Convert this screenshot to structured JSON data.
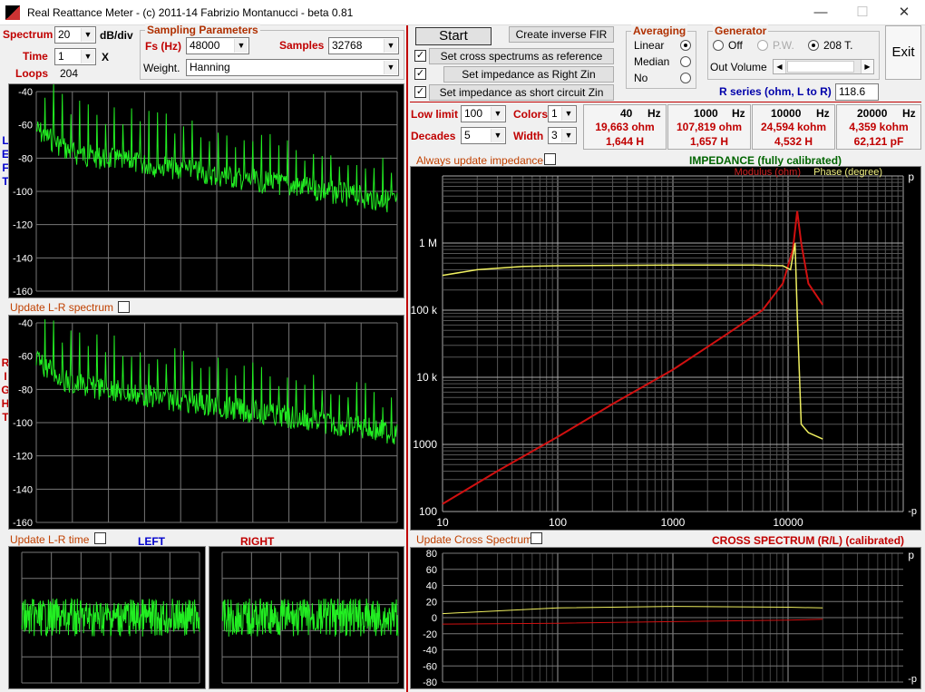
{
  "window": {
    "title": "Real Reattance Meter - (c) 2011-14 Fabrizio Montanucci - beta 0.81"
  },
  "left": {
    "spectrum_label": "Spectrum",
    "spectrum_value": "20",
    "spectrum_unit": "dB/div",
    "time_label": "Time",
    "time_value": "1",
    "time_unit": "X",
    "loops_label": "Loops",
    "loops_value": "204",
    "sampling_title": "Sampling Parameters",
    "fs_label": "Fs (Hz)",
    "fs_value": "48000",
    "samples_label": "Samples",
    "samples_value": "32768",
    "weight_label": "Weight.",
    "weight_value": "Hanning",
    "left_side_letters": [
      "L",
      "E",
      "F",
      "T"
    ],
    "right_side_letters": [
      "R",
      "I",
      "G",
      "H",
      "T"
    ],
    "spectrum_ticks": [
      "-40",
      "-60",
      "-80",
      "-100",
      "-120",
      "-140",
      "-160"
    ],
    "update_lr_spectrum": "Update L-R spectrum",
    "update_lr_time": "Update L-R time",
    "time_left_title": "LEFT",
    "time_right_title": "RIGHT"
  },
  "controls": {
    "start": "Start",
    "create_fir": "Create inverse FIR",
    "cross_ref": "Set cross spectrums as reference",
    "imp_right": "Set impedance as Right Zin",
    "imp_short": "Set impedance as short circuit Zin",
    "avg_title": "Averaging",
    "avg_linear": "Linear",
    "avg_median": "Median",
    "avg_no": "No",
    "gen_title": "Generator",
    "gen_off": "Off",
    "gen_pw": "P.W.",
    "gen_208": "208 T.",
    "out_volume": "Out Volume",
    "exit": "Exit",
    "rseries_label": "R series (ohm, L to R)",
    "rseries_value": "118.6",
    "low_limit_label": "Low limit",
    "low_limit_value": "100",
    "decades_label": "Decades",
    "decades_value": "5",
    "colors_label": "Colors",
    "colors_value": "1",
    "width_label": "Width",
    "width_value": "3",
    "always_update": "Always update impedance"
  },
  "readouts": [
    {
      "freq": "40",
      "unit": "Hz",
      "r": "19,663 ohm",
      "x": "1,644 H"
    },
    {
      "freq": "1000",
      "unit": "Hz",
      "r": "107,819 ohm",
      "x": "1,657 H"
    },
    {
      "freq": "10000",
      "unit": "Hz",
      "r": "24,594 kohm",
      "x": "4,532 H"
    },
    {
      "freq": "20000",
      "unit": "Hz",
      "r": "4,359 kohm",
      "x": "62,121 pF"
    }
  ],
  "impedance": {
    "title": "IMPEDANCE (fully calibrated)",
    "legend_mod": "Modulus (ohm)",
    "legend_phase": "Phase (degree)",
    "y_ticks": [
      "1 M",
      "100 k",
      "10 k",
      "1000",
      "100"
    ],
    "x_ticks": [
      "10",
      "100",
      "1000",
      "10000"
    ],
    "right_top": "p",
    "right_bottom": "-p",
    "colors": {
      "modulus": "#d01010",
      "phase": "#f0f060",
      "grid": "#888888"
    }
  },
  "cross": {
    "update_label": "Update Cross Spectrum",
    "title": "CROSS SPECTRUM (R/L) (calibrated)",
    "y_ticks": [
      "80",
      "60",
      "40",
      "20",
      "0",
      "-20",
      "-40",
      "-60",
      "-80"
    ],
    "right_top": "p",
    "right_bottom": "-p"
  },
  "chart_data": [
    {
      "type": "line",
      "title": "IMPEDANCE (fully calibrated)",
      "xscale": "log",
      "yscale": "log",
      "xlim": [
        10,
        100000
      ],
      "ylim": [
        100,
        10000000
      ],
      "series": [
        {
          "name": "Modulus (ohm)",
          "x": [
            10,
            30,
            100,
            300,
            1000,
            3000,
            6000,
            9000,
            11000,
            12000,
            13000,
            15000,
            20000
          ],
          "y": [
            130,
            400,
            1300,
            4000,
            13000,
            45000,
            100000,
            250000,
            800000,
            3000000,
            1000000,
            250000,
            120000
          ]
        },
        {
          "name": "Phase (degree)",
          "x": [
            10,
            20,
            50,
            100,
            1000,
            5000,
            9000,
            10500,
            11500,
            12000,
            13000,
            15000,
            20000
          ],
          "y": [
            330000,
            400000,
            450000,
            460000,
            470000,
            470000,
            460000,
            400000,
            1000000,
            90000,
            2000,
            1500,
            1200
          ]
        }
      ]
    },
    {
      "type": "line",
      "title": "CROSS SPECTRUM (R/L) (calibrated)",
      "xscale": "log",
      "ylim": [
        -80,
        80
      ],
      "series": [
        {
          "x": [
            10,
            100,
            1000,
            10000,
            20000
          ],
          "y": [
            5,
            12,
            14,
            13,
            12
          ]
        },
        {
          "x": [
            10,
            100,
            1000,
            10000,
            20000
          ],
          "y": [
            -8,
            -7,
            -5,
            -3,
            -2
          ]
        }
      ]
    }
  ]
}
